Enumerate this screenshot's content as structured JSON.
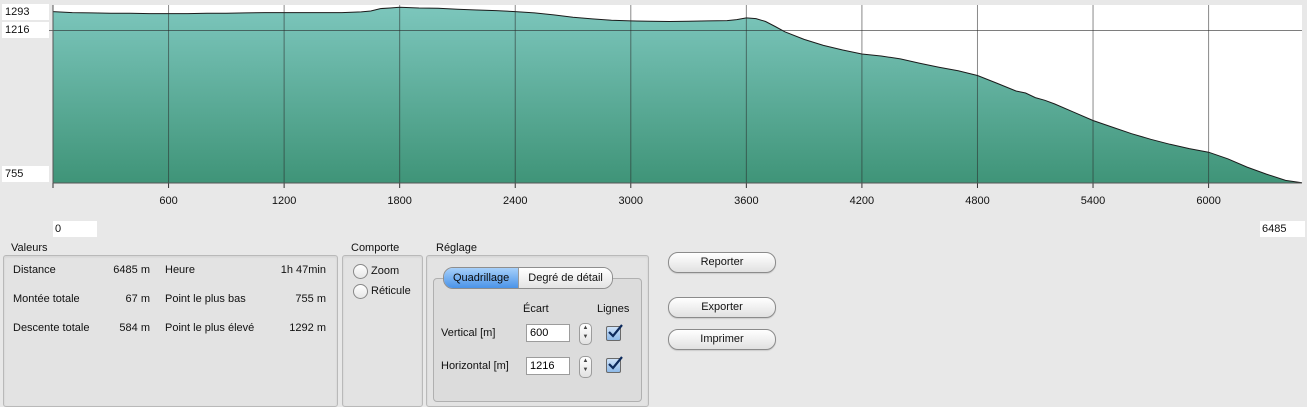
{
  "chart_data": {
    "type": "area",
    "x_unit": "m",
    "y_unit": "m",
    "xlim": [
      0,
      6485
    ],
    "ylim": [
      755,
      1293
    ],
    "x_ticks": [
      600,
      1200,
      1800,
      2400,
      3000,
      3600,
      4200,
      4800,
      5400,
      6000
    ],
    "y_ticks": [
      1216
    ],
    "grid": true,
    "fill_color": "#62b09e",
    "profile": {
      "x": [
        0,
        100,
        200,
        300,
        400,
        500,
        600,
        700,
        800,
        900,
        1000,
        1100,
        1200,
        1300,
        1400,
        1500,
        1600,
        1650,
        1700,
        1750,
        1800,
        1850,
        1900,
        2000,
        2100,
        2200,
        2300,
        2400,
        2500,
        2600,
        2700,
        2800,
        2900,
        3000,
        3100,
        3200,
        3300,
        3400,
        3500,
        3550,
        3600,
        3650,
        3700,
        3750,
        3800,
        3900,
        4000,
        4100,
        4200,
        4300,
        4400,
        4500,
        4600,
        4700,
        4800,
        4900,
        5000,
        5050,
        5100,
        5150,
        5200,
        5300,
        5400,
        5500,
        5600,
        5700,
        5800,
        5900,
        6000,
        6100,
        6200,
        6300,
        6400,
        6485
      ],
      "y": [
        1273,
        1270,
        1269,
        1268,
        1268,
        1267,
        1267,
        1267,
        1268,
        1268,
        1269,
        1270,
        1270,
        1270,
        1270,
        1270,
        1272,
        1275,
        1282,
        1284,
        1286,
        1285,
        1284,
        1283,
        1280,
        1278,
        1276,
        1273,
        1269,
        1263,
        1256,
        1251,
        1247,
        1245,
        1244,
        1243,
        1244,
        1245,
        1246,
        1249,
        1254,
        1252,
        1243,
        1228,
        1212,
        1189,
        1171,
        1157,
        1145,
        1139,
        1130,
        1117,
        1105,
        1094,
        1080,
        1057,
        1033,
        1027,
        1013,
        1005,
        994,
        969,
        944,
        924,
        904,
        887,
        872,
        859,
        848,
        828,
        803,
        782,
        763,
        756
      ]
    }
  },
  "chart_labels": {
    "y_top": "1293",
    "y_grid": "1216",
    "y_bottom": "755",
    "x_start": "0",
    "x_end": "6485",
    "x_ticks": [
      "600",
      "1200",
      "1800",
      "2400",
      "3000",
      "3600",
      "4200",
      "4800",
      "5400",
      "6000"
    ]
  },
  "valeurs": {
    "title": "Valeurs",
    "rows": [
      {
        "l1": "Distance",
        "v1": "6485 m",
        "l2": "Heure",
        "v2": "1h 47min"
      },
      {
        "l1": "Montée totale",
        "v1": "67 m",
        "l2": "Point le plus bas",
        "v2": "755 m"
      },
      {
        "l1": "Descente totale",
        "v1": "584 m",
        "l2": "Point le plus élevé",
        "v2": "1292 m"
      }
    ]
  },
  "comporte": {
    "title": "Comporte",
    "zoom_label": "Zoom",
    "reticule_label": "Réticule"
  },
  "reglage": {
    "title": "Réglage",
    "tab_quadrillage": "Quadrillage",
    "tab_detail": "Degré de détail",
    "col_ecart": "Écart",
    "col_lignes": "Lignes",
    "vertical_label": "Vertical [m]",
    "vertical_value": "600",
    "vertical_checked": true,
    "horizontal_label": "Horizontal [m]",
    "horizontal_value": "1216",
    "horizontal_checked": true
  },
  "buttons": {
    "reporter": "Reporter",
    "exporter": "Exporter",
    "imprimer": "Imprimer"
  }
}
